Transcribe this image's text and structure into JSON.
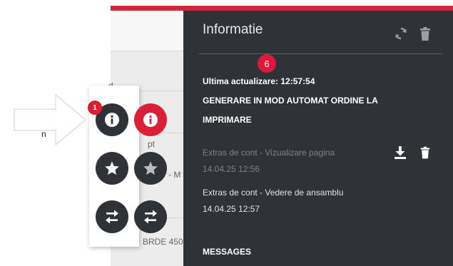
{
  "background": {
    "header_fragment": "d",
    "row_fragment_1": "pt",
    "row_fragment_2": "- M",
    "row_fragment_3": "BRDE 450",
    "left_fragment": "n"
  },
  "panel": {
    "title": "Informatie",
    "icons": {
      "refresh": "refresh-icon",
      "delete": "trash-icon"
    },
    "badge_count": "6",
    "last_update": "Ultima actualizare: 12:57:54",
    "heading_line1": "GENERARE IN MOD AUTOMAT ORDINE LA",
    "heading_line2": "IMPRIMARE",
    "items": [
      {
        "title": "Extras de cont - Vizualizare pagina",
        "timestamp": "14.04.25 12:56"
      },
      {
        "title": "Extras de cont - Vedere de ansamblu",
        "timestamp": "14.04.25 12:57"
      }
    ],
    "messages_label": "MESSAGES"
  },
  "fab": {
    "badge_count": "1",
    "buttons": [
      "info-icon",
      "star-icon",
      "swap-icon"
    ]
  },
  "colors": {
    "brand_red": "#dc1f38",
    "panel_bg": "#2f3338",
    "badge_red": "#e0173a"
  }
}
